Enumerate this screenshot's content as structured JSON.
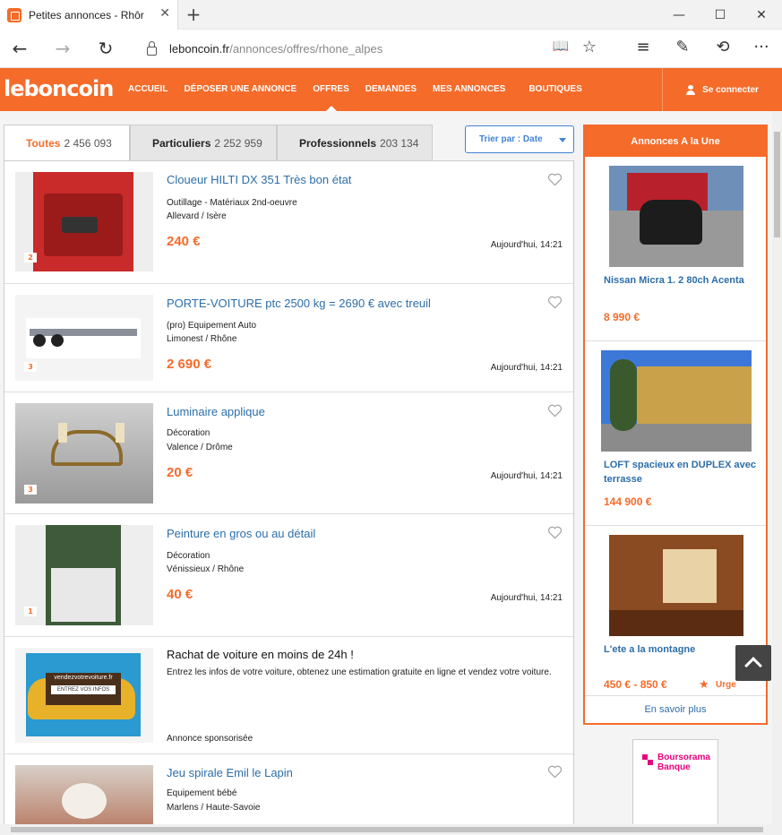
{
  "browser": {
    "tab_title": "Petites annonces - Rhôr",
    "tab_close": "✕",
    "new_tab": "+",
    "url_domain": "leboncoin.fr",
    "url_path": "/annonces/offres/rhone_alpes",
    "controls": {
      "minimize": "—",
      "maximize": "☐",
      "close": "✕"
    },
    "back": "←",
    "forward": "→",
    "refresh": "↻",
    "reading": "📖",
    "favorite": "☆",
    "hub": "≡",
    "note": "✎",
    "share": "⟲",
    "more": "···"
  },
  "site": {
    "logo": "leboncoin",
    "menu": [
      "ACCUEIL",
      "DÉPOSER UNE ANNONCE",
      "OFFRES",
      "DEMANDES",
      "MES ANNONCES",
      "BOUTIQUES"
    ],
    "login_label": "Se connecter"
  },
  "filters": [
    {
      "label": "Toutes",
      "count": "2 456 093"
    },
    {
      "label": "Particuliers",
      "count": "2 252 959"
    },
    {
      "label": "Professionnels",
      "count": "203 134"
    }
  ],
  "sort": {
    "label": "Trier par : Date"
  },
  "listings": [
    {
      "title": "Cloueur HILTI DX 351 Très bon état",
      "category": "Outillage - Matériaux 2nd-oeuvre",
      "location": "Allevard / Isère",
      "price": "240 €",
      "date": "Aujourd'hui, 14:21",
      "photos": "2"
    },
    {
      "title": "PORTE-VOITURE ptc 2500 kg = 2690 € avec treuil",
      "category": "(pro) Equipement Auto",
      "location": "Limonest / Rhône",
      "price": "2 690 €",
      "date": "Aujourd'hui, 14:21",
      "photos": "3"
    },
    {
      "title": "Luminaire applique",
      "category": "Décoration",
      "location": "Valence / Drôme",
      "price": "20 €",
      "date": "Aujourd'hui, 14:21",
      "photos": "3"
    },
    {
      "title": "Peinture en gros ou au détail",
      "category": "Décoration",
      "location": "Vénissieux / Rhône",
      "price": "40 €",
      "date": "Aujourd'hui, 14:21",
      "photos": "1"
    }
  ],
  "sponsored": {
    "title": "Rachat de voiture en moins de 24h !",
    "description": "Entrez les infos de votre voiture, obtenez une estimation gratuite en ligne et vendez votre voiture.",
    "tag": "Annonce sponsorisée",
    "image_text": "vendezvotrevoiture.fr",
    "image_button": "ENTREZ VOS INFOS"
  },
  "last_listing": {
    "title": "Jeu spirale Emil le Lapin",
    "category": "Equipement bébé",
    "location": "Marlens / Haute-Savoie"
  },
  "sidebar": {
    "header": "Annonces A la Une",
    "items": [
      {
        "title": "Nissan Micra 1. 2 80ch Acenta",
        "price": "8 990 €"
      },
      {
        "title": "LOFT spacieux en DUPLEX avec terrasse",
        "price": "144 900 €"
      },
      {
        "title": "L'ete a la montagne",
        "price": "450 € - 850 €",
        "badge": "Urge"
      }
    ],
    "more": "En savoir plus"
  },
  "ad": {
    "brand_line1": "Boursorama",
    "brand_line2": "Banque"
  },
  "colors": {
    "brand": "#f56b2a",
    "link": "#2c6ea8",
    "accent_blue": "#4183d7"
  }
}
